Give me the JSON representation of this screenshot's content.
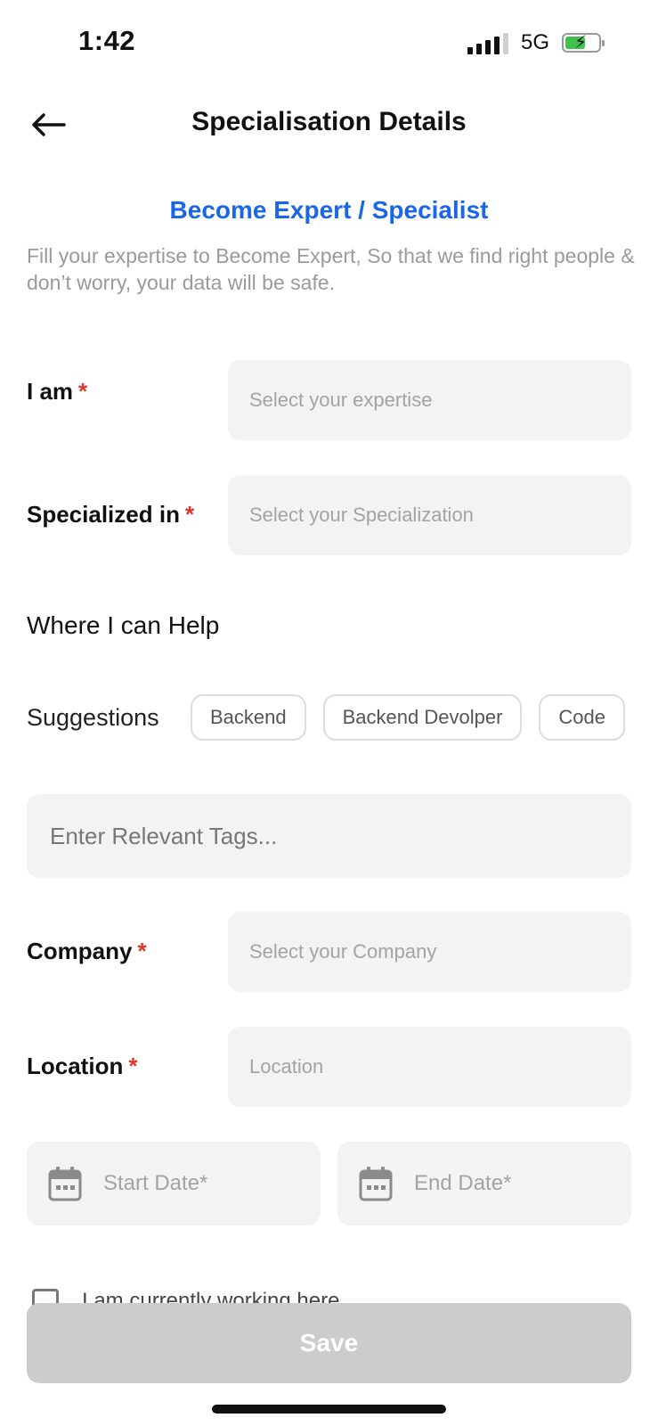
{
  "status": {
    "time": "1:42",
    "network": "5G",
    "battery_icon": "battery-charging-icon"
  },
  "header": {
    "title": "Specialisation Details",
    "back_icon": "arrow-left-icon"
  },
  "intro": {
    "subtitle": "Become Expert / Specialist",
    "description": "Fill your expertise to Become Expert, So that we find right people & don’t worry, your data will be safe."
  },
  "form": {
    "required_mark": "*",
    "i_am": {
      "label": "I am",
      "placeholder": "Select your expertise"
    },
    "specialized": {
      "label": "Specialized in",
      "placeholder": "Select your Specialization"
    },
    "help_section": "Where I can Help",
    "suggestions_label": "Suggestions",
    "suggestions": [
      "Backend",
      "Backend Devolper",
      "Code"
    ],
    "tags_placeholder": "Enter Relevant Tags...",
    "company": {
      "label": "Company",
      "placeholder": "Select your Company"
    },
    "location": {
      "label": "Location",
      "placeholder": "Location"
    },
    "start_date": {
      "placeholder": "Start Date*",
      "icon": "calendar-icon"
    },
    "end_date": {
      "placeholder": "End Date*",
      "icon": "calendar-icon"
    },
    "checkbox_label": "I am currently working here"
  },
  "actions": {
    "save_label": "Save"
  },
  "colors": {
    "accent": "#1a66e8",
    "required": "#e0352b",
    "field_bg": "#f3f3f3",
    "save_disabled": "#cccccc"
  }
}
